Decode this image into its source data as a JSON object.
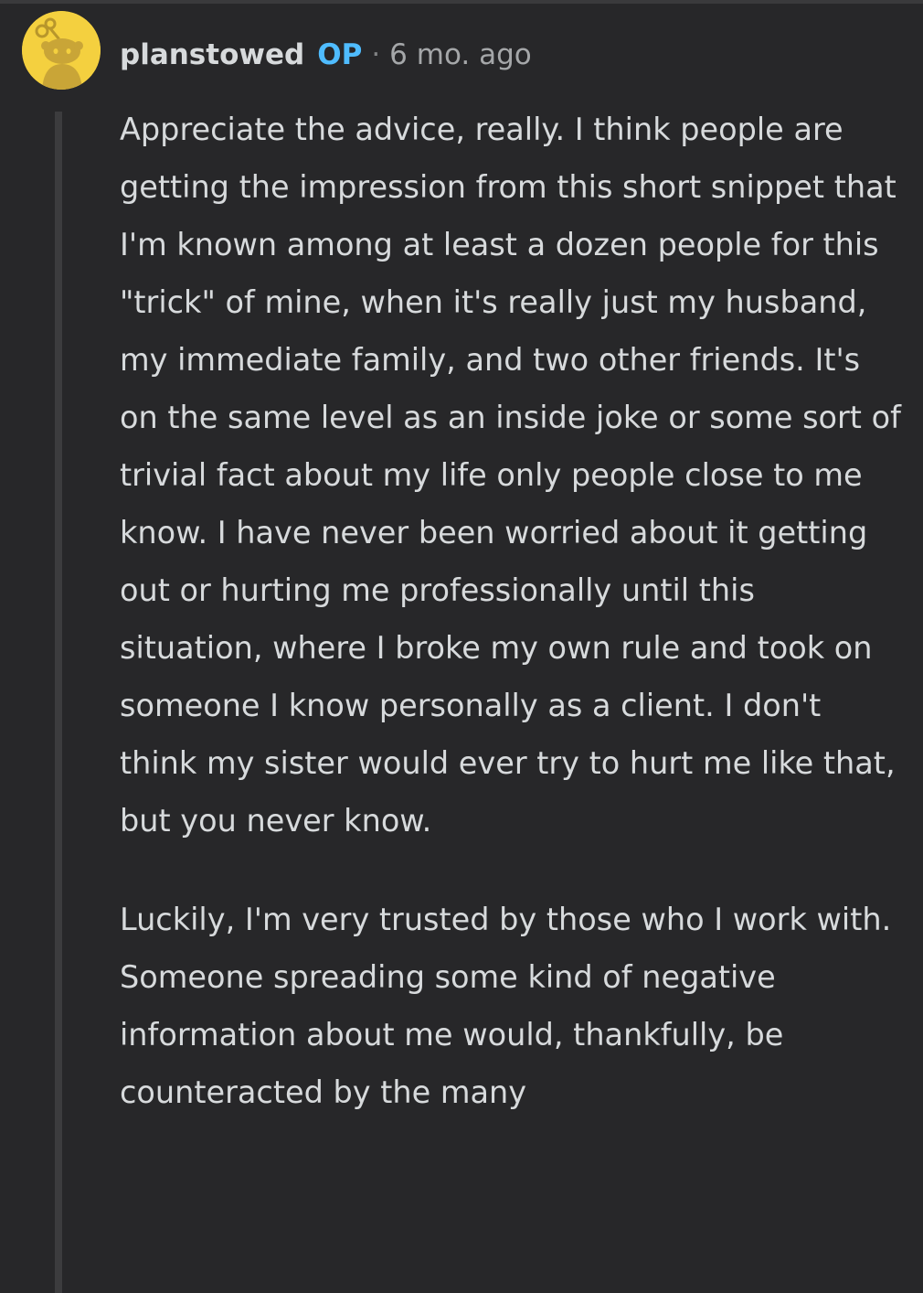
{
  "comment": {
    "author": "planstowed",
    "author_badge": "OP",
    "separator": "·",
    "timestamp": "6 mo. ago",
    "avatar_icon": "snoo-avatar-icon",
    "paragraphs": [
      "Appreciate the advice, really. I think people are getting the impression from this short snippet that I'm known among at least a dozen people for this \"trick\" of mine, when it's really just my husband, my immediate family, and two other friends. It's on the same level as an inside joke or some sort of trivial fact about my life only people close to me know. I have never been worried about it getting out or hurting me professionally until this situation, where I broke my own rule and took on someone I know personally as a client. I don't think my sister would ever try to hurt me like that, but you never know.",
      "Luckily, I'm very trusted by those who I work with. Someone spreading some kind of negative information about me would, thankfully, be counteracted by the many"
    ]
  },
  "colors": {
    "background": "#272729",
    "text": "#d7dadc",
    "op_badge": "#4fbcff",
    "muted": "#a5a7a9",
    "avatar_bg": "#f4d03f",
    "thread_line": "#3c3c3e"
  }
}
